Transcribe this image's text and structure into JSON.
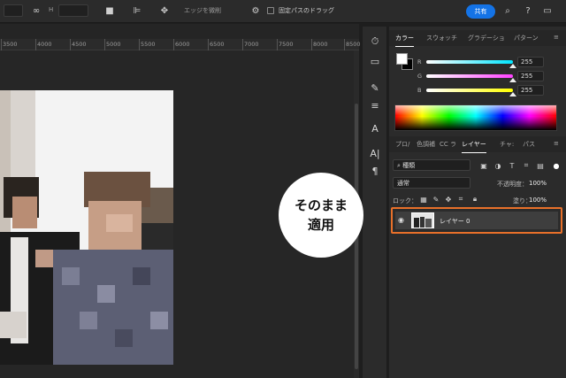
{
  "toolbar": {
    "h_label": "H",
    "edge_button": "エッジを微削",
    "fixed_path_drag": "固定パスのドラッグ",
    "share_label": "共有"
  },
  "ruler": {
    "ticks": [
      "3500",
      "4000",
      "4500",
      "5000",
      "5500",
      "6000",
      "6500",
      "7000",
      "7500",
      "8000",
      "8500"
    ]
  },
  "color_panel": {
    "tabs": [
      "カラー",
      "スウォッチ",
      "グラデーショ",
      "パターン"
    ],
    "active_tab": "カラー",
    "channels": [
      {
        "label": "R",
        "value": "255",
        "color": "#00e5ff"
      },
      {
        "label": "G",
        "value": "255",
        "color": "#ff40ff"
      },
      {
        "label": "B",
        "value": "255",
        "color": "#ffff00"
      }
    ]
  },
  "layers_panel": {
    "tabs": [
      "プロ/",
      "色調補",
      "CC ラ",
      "レイヤー",
      "チャ:",
      "パス"
    ],
    "active_tab": "レイヤー",
    "filter_label": "種類",
    "blend_mode": "通常",
    "opacity_label": "不透明度：",
    "opacity_value": "100%",
    "lock_label": "ロック：",
    "fill_label": "塗り：",
    "fill_value": "100%",
    "layer_name": "レイヤー 0"
  },
  "badge": {
    "line1": "そのまま",
    "line2": "適用"
  },
  "colors": {
    "highlight": "#e8702a",
    "accent": "#1473e6"
  }
}
